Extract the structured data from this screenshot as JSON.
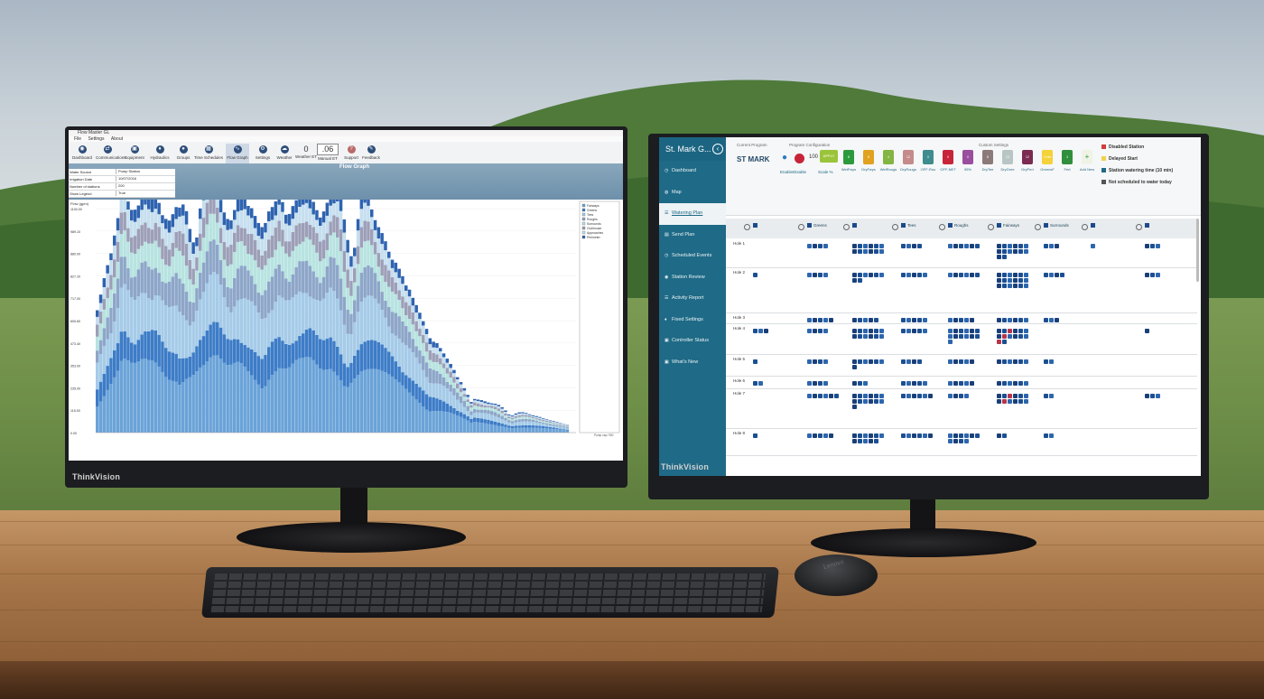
{
  "left_app": {
    "window_title": "Flow Master GL",
    "menu": [
      "File",
      "Settings",
      "About"
    ],
    "toolbar": [
      {
        "label": "Dashboard",
        "icon": "dashboard-icon"
      },
      {
        "label": "Communications",
        "icon": "communications-icon"
      },
      {
        "label": "Equipment",
        "icon": "equipment-icon"
      },
      {
        "label": "Hydraulics",
        "icon": "hydraulics-icon"
      },
      {
        "label": "Groups",
        "icon": "groups-icon"
      },
      {
        "label": "Time Schedules",
        "icon": "calendar-icon"
      },
      {
        "label": "Flow Graph",
        "icon": "flow-graph-icon",
        "active": true
      },
      {
        "label": "Settings",
        "icon": "settings-icon"
      },
      {
        "label": "Weather",
        "icon": "weather-icon"
      },
      {
        "label": "Weather ET",
        "value": "0"
      },
      {
        "label": "Manual ET",
        "value": ".06"
      },
      {
        "label": "Support",
        "icon": "support-icon"
      },
      {
        "label": "Feedback",
        "icon": "feedback-icon"
      }
    ],
    "banner_title": "Flow Graph",
    "params": [
      {
        "key": "Water Source",
        "value": "Pump Station"
      },
      {
        "key": "Irrigation Date",
        "value": "10/07/2016"
      },
      {
        "key": "Number of stations",
        "value": "200"
      },
      {
        "key": "Show Legend",
        "value": "True"
      }
    ],
    "chart_data": {
      "type": "area",
      "ylabel": "Flow (gpm)",
      "yticks": [
        "1100.00",
        "989.10",
        "880.00",
        "827.20",
        "717.00",
        "605.60",
        "473.40",
        "353.00",
        "235.00",
        "115.00",
        "0.00"
      ],
      "legend": [
        "Fairways",
        "Greens",
        "Tees",
        "Roughs",
        "Surrounds",
        "Clubhouse",
        "Approaches",
        "Perimeter"
      ],
      "footer": "Pump cap: 900",
      "series": [
        {
          "name": "Fairways",
          "color": "#6aa3d8"
        },
        {
          "name": "Greens",
          "color": "#3d7cc7"
        },
        {
          "name": "Tees",
          "color": "#a5cbe8"
        },
        {
          "name": "Roughs",
          "color": "#8da6c9"
        },
        {
          "name": "Surrounds",
          "color": "#b7e3e0"
        },
        {
          "name": "Clubhouse",
          "color": "#9d9fb8"
        },
        {
          "name": "Approaches",
          "color": "#c6dfef"
        },
        {
          "name": "Perimeter",
          "color": "#2f63b0"
        }
      ]
    }
  },
  "right_app": {
    "site_name": "St. Mark G...",
    "nav": [
      {
        "label": "Dashboard",
        "icon": "dashboard-icon"
      },
      {
        "label": "Map",
        "icon": "map-pin-icon"
      },
      {
        "label": "Watering Plan",
        "icon": "list-icon",
        "active": true
      },
      {
        "label": "Send Plan",
        "icon": "send-icon"
      },
      {
        "label": "Scheduled Events",
        "icon": "clock-icon"
      },
      {
        "label": "Station Review",
        "icon": "review-icon"
      },
      {
        "label": "Activity Report",
        "icon": "report-icon"
      },
      {
        "label": "Fixed Settings",
        "icon": "pin-icon"
      },
      {
        "label": "Controller Status",
        "icon": "status-icon"
      },
      {
        "label": "What's New",
        "icon": "new-icon"
      }
    ],
    "current_program_label": "Current Program",
    "current_program": "ST MARK",
    "program_config_label": "Program Configuration",
    "enable_label": "Enable",
    "disable_label": "Disable",
    "scale_label": "Scale %",
    "scale_value": "100",
    "apply_label": "APPLY",
    "custom_settings_label": "Custom Settings",
    "custom_tiles": [
      {
        "label": "WetFwys",
        "value": "8",
        "color": "#2c9a3c"
      },
      {
        "label": "DryFwys",
        "value": "8",
        "color": "#e0a21f"
      },
      {
        "label": "WetRougs",
        "value": "4",
        "color": "#82b541"
      },
      {
        "label": "DryRougs",
        "value": "12",
        "color": "#c58a8a"
      },
      {
        "label": "OFF-Rou",
        "value": "0",
        "color": "#3e8c8e"
      },
      {
        "label": "OFF-NET",
        "value": "0",
        "color": "#c7243a"
      },
      {
        "label": "95%",
        "value": "0",
        "color": "#9a4e9e"
      },
      {
        "label": "DryTee",
        "value": "8",
        "color": "#8c7a7a"
      },
      {
        "label": "DryGree",
        "value": "10",
        "color": "#b7c5c4"
      },
      {
        "label": "DryPeri",
        "value": "12",
        "color": "#7b2a52"
      },
      {
        "label": "GreensF",
        "value": "3 min",
        "color": "#f3d23a"
      },
      {
        "label": "Fert",
        "value": "3",
        "color": "#2f8f3c"
      },
      {
        "label": "Add New",
        "value": "+",
        "color": "#eef3e6"
      }
    ],
    "legend": [
      {
        "label": "Disabled Station",
        "color": "#d13c3c"
      },
      {
        "label": "Delayed Start",
        "color": "#f1d24a"
      },
      {
        "label": "Station watering time (10 min)",
        "color": "#1f6a86"
      },
      {
        "label": "Not scheduled to water today",
        "color": "#555555"
      }
    ],
    "groups": [
      {
        "name": ""
      },
      {
        "name": "Greens"
      },
      {
        "name": ""
      },
      {
        "name": "Tees"
      },
      {
        "name": "Roughs"
      },
      {
        "name": "Fairways"
      },
      {
        "name": "Surrounds"
      },
      {
        "name": ""
      },
      {
        "name": ""
      }
    ],
    "rows": [
      {
        "hole": "Hole 1",
        "cells": [
          0,
          4,
          12,
          4,
          6,
          14,
          3,
          1,
          3
        ]
      },
      {
        "hole": "Hole 2",
        "cells": [
          1,
          4,
          8,
          5,
          6,
          18,
          4,
          0,
          3
        ]
      },
      {
        "hole": "Hole 3",
        "cells": [
          0,
          5,
          5,
          5,
          5,
          6,
          3,
          0,
          0
        ]
      },
      {
        "hole": "Hole 4",
        "cells": [
          3,
          4,
          12,
          5,
          13,
          14,
          0,
          0,
          1
        ]
      },
      {
        "hole": "Hole 5",
        "cells": [
          1,
          4,
          7,
          4,
          5,
          6,
          2,
          0,
          0
        ]
      },
      {
        "hole": "Hole 6",
        "cells": [
          2,
          4,
          3,
          5,
          5,
          6,
          0,
          0,
          0
        ]
      },
      {
        "hole": "Hole 7",
        "cells": [
          0,
          6,
          13,
          6,
          4,
          12,
          2,
          0,
          3
        ]
      },
      {
        "hole": "Hole 8",
        "cells": [
          1,
          5,
          11,
          6,
          10,
          2,
          2,
          0,
          0
        ]
      }
    ]
  },
  "devices": {
    "monitor_brand": "ThinkVision",
    "mouse_brand": "Lenovo"
  }
}
